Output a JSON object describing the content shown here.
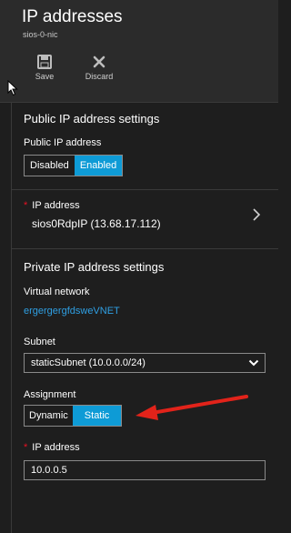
{
  "header": {
    "title": "IP addresses",
    "subtitle": "sios-0-nic",
    "toolbar": {
      "save_label": "Save",
      "discard_label": "Discard"
    }
  },
  "public_ip": {
    "section_title": "Public IP address settings",
    "field_label": "Public IP address",
    "options": [
      "Disabled",
      "Enabled"
    ],
    "selected": "Enabled",
    "ip_label": "IP address",
    "ip_value": "sios0RdpIP (13.68.17.112)"
  },
  "private_ip": {
    "section_title": "Private IP address settings",
    "vnet_label": "Virtual network",
    "vnet_value": "ergergergfdsweVNET",
    "subnet_label": "Subnet",
    "subnet_value": "staticSubnet (10.0.0.0/24)",
    "assignment_label": "Assignment",
    "assignment_options": [
      "Dynamic",
      "Static"
    ],
    "assignment_selected": "Static",
    "ip_label": "IP address",
    "ip_value": "10.0.0.5"
  },
  "colors": {
    "accent": "#0e9bd6",
    "link": "#2f9fe3",
    "required": "#e81123",
    "annotation_arrow": "#e2231a"
  }
}
